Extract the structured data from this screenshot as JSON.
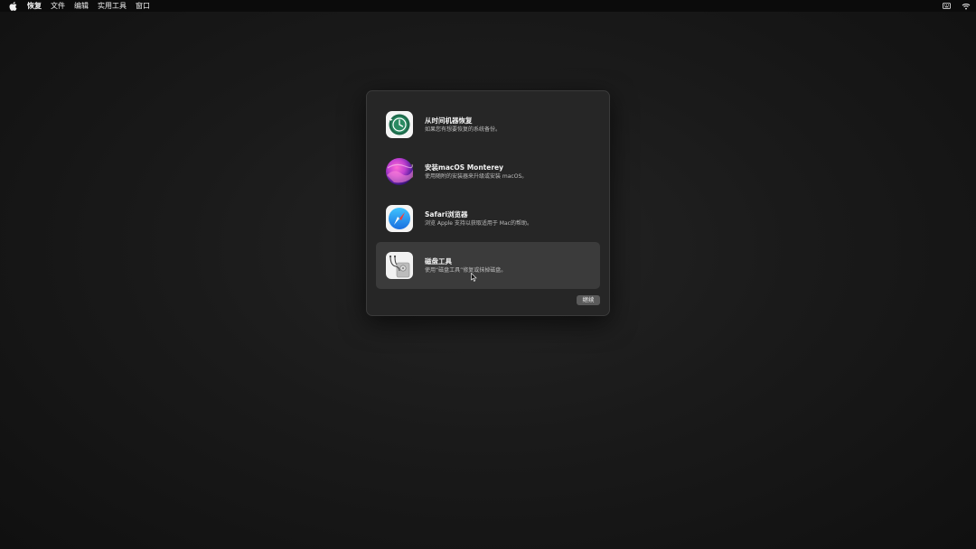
{
  "menubar": {
    "apple_icon": "apple-icon",
    "items": [
      "恢复",
      "文件",
      "编辑",
      "实用工具",
      "窗口"
    ],
    "right_icons": [
      "keyboard-input-icon",
      "wifi-icon"
    ]
  },
  "panel": {
    "options": [
      {
        "icon": "time-machine-icon",
        "title": "从时间机器恢复",
        "description": "如果您有想要恢复的系统备份。"
      },
      {
        "icon": "macos-monterey-icon",
        "title": "安装macOS Monterey",
        "description": "使用随附的安装器来升级或安装 macOS。"
      },
      {
        "icon": "safari-icon",
        "title": "Safari浏览器",
        "description": "浏览 Apple 支持以获取适用于 Mac的帮助。"
      },
      {
        "icon": "disk-utility-icon",
        "title": "磁盘工具",
        "description": "使用“磁盘工具”修复或抹掉磁盘。"
      }
    ],
    "selected_index": 3,
    "continue_label": "继续"
  },
  "colors": {
    "menubar_bg": "#0b0b0b",
    "panel_bg": "#262626",
    "selected_row": "#3b3b3b",
    "button_bg": "#5a5a5a"
  }
}
